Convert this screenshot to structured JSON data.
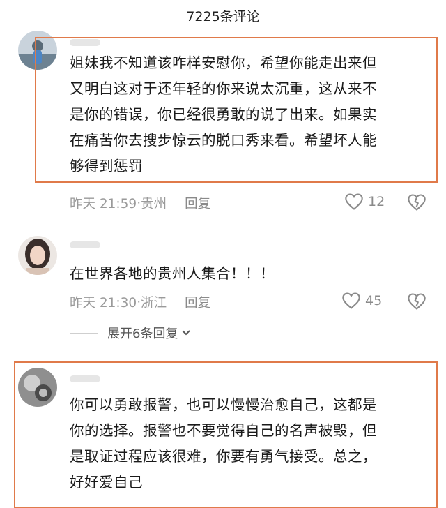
{
  "header": {
    "title": "7225条评论"
  },
  "comments": [
    {
      "lines": [
        "姐妹我不知道该咋样安慰你，希望你能走出来但",
        "又明白这对于还年轻的你来说太沉重，这从来不",
        "是你的错误，你已经很勇敢的说了出来。如果实",
        "在痛苦你去搜步惊云的脱口秀来看。希望坏人能",
        "够得到惩罚"
      ],
      "time": "昨天 21:59",
      "location": "贵州",
      "reply_label": "回复",
      "likes": "12"
    },
    {
      "lines": [
        "在世界各地的贵州人集合！！！"
      ],
      "time": "昨天 21:30",
      "location": "浙江",
      "reply_label": "回复",
      "likes": "45",
      "expand_label": "展开6条回复"
    },
    {
      "lines": [
        "你可以勇敢报警，也可以慢慢治愈自己，这都是",
        "你的选择。报警也不要觉得自己的名声被毁，但",
        "是取证过程应该很难，你要有勇气接受。总之，",
        "好好爱自己"
      ]
    }
  ],
  "colors": {
    "highlight_frame": "#e07a4a",
    "meta_text": "#9a9a9a"
  },
  "icons": [
    "heart-outline-icon",
    "broken-heart-icon",
    "chevron-down-icon"
  ]
}
